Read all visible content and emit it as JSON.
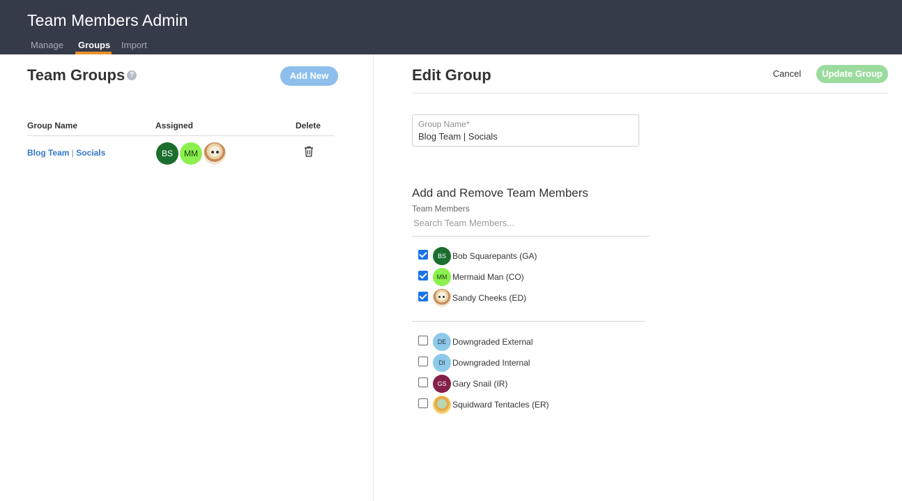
{
  "app": {
    "title": "Team Members Admin"
  },
  "nav": {
    "tabs": [
      {
        "label": "Manage"
      },
      {
        "label": "Groups"
      },
      {
        "label": "Import"
      }
    ],
    "active": "Groups"
  },
  "left": {
    "title": "Team Groups",
    "help": "?",
    "add_new_label": "Add New",
    "columns": [
      "Group Name",
      "Assigned",
      "Delete"
    ],
    "rows": [
      {
        "name_part1": "Blog Team",
        "separator": "|",
        "name_part2": "Socials",
        "assigned": [
          {
            "initials": "BS",
            "color": "#1b6e2d"
          },
          {
            "initials": "MM",
            "color": "#8bf04e"
          },
          {
            "initials": "",
            "image": "sandy-avatar"
          }
        ]
      }
    ]
  },
  "edit": {
    "title": "Edit Group",
    "cancel_label": "Cancel",
    "update_label": "Update Group",
    "group_name_label": "Group Name*",
    "group_name_value": "Blog Team | Socials",
    "section_title": "Add and Remove Team Members",
    "members_label": "Team Members",
    "search_placeholder": "Search Team Members...",
    "selected": [
      {
        "initials": "BS",
        "name": "Bob Squarepants (GA)",
        "color": "#1b6e2d",
        "checked": true
      },
      {
        "initials": "MM",
        "name": "Mermaid Man (CO)",
        "color": "#8bf04e",
        "checked": true
      },
      {
        "initials": "",
        "name": "Sandy Cheeks (ED)",
        "image": "sandy-avatar",
        "checked": true
      }
    ],
    "unselected": [
      {
        "initials": "DE",
        "name": "Downgraded External",
        "color": "#8ec9ea",
        "checked": false
      },
      {
        "initials": "DI",
        "name": "Downgraded Internal",
        "color": "#8ec9ea",
        "checked": false
      },
      {
        "initials": "GS",
        "name": "Gary Snail (IR)",
        "color": "#84204a",
        "checked": false
      },
      {
        "initials": "",
        "name": "Squidward Tentacles (ER)",
        "image": "squidward-avatar",
        "checked": false
      }
    ]
  },
  "colors": {
    "header_bg": "#363b4a",
    "accent": "#e8912d",
    "link": "#3677c8",
    "add_new_bg": "#8ebfec",
    "update_bg": "#9bdc9e",
    "checkbox": "#1a73e8"
  }
}
